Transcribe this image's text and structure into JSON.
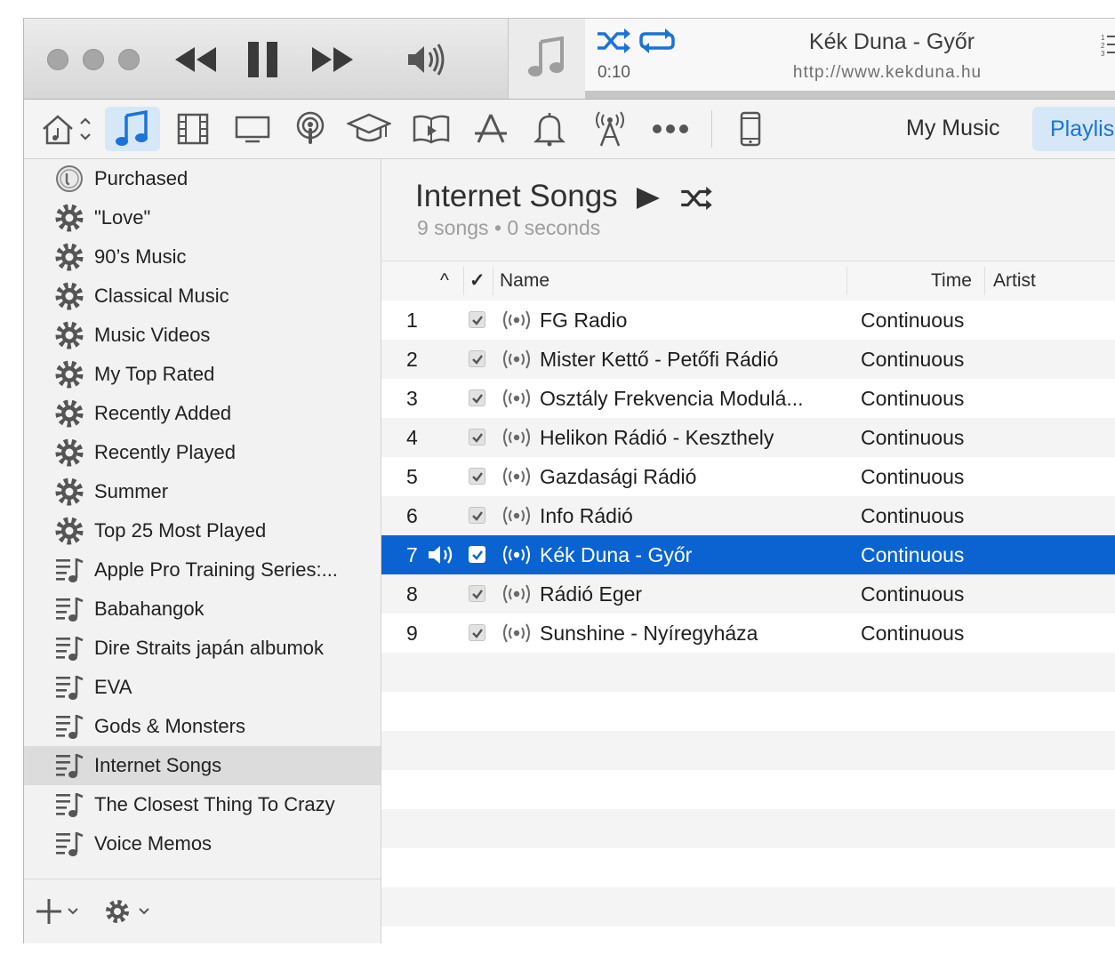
{
  "colors": {
    "accent": "#0a63d1",
    "selected_nav_bg": "#d6e7f7",
    "toolbar_icon": "#555555"
  },
  "now_playing": {
    "title": "Kék Duna - Győr",
    "subtitle": "http://www.kekduna.hu",
    "elapsed": "0:10"
  },
  "nav": {
    "icons": [
      "home-music-icon",
      "music-icon",
      "movies-icon",
      "tv-icon",
      "podcasts-icon",
      "itunes-u-icon",
      "books-icon",
      "apps-icon",
      "tones-icon",
      "radio-icon",
      "more-icon",
      "device-icon"
    ],
    "my_music": "My Music",
    "playlists": "Playlis"
  },
  "sidebar": {
    "items": [
      {
        "label": "Purchased",
        "icon": "purchased-icon"
      },
      {
        "label": "\"Love\"",
        "icon": "smart-playlist-gear-icon"
      },
      {
        "label": "90’s Music",
        "icon": "smart-playlist-gear-icon"
      },
      {
        "label": "Classical Music",
        "icon": "smart-playlist-gear-icon"
      },
      {
        "label": "Music Videos",
        "icon": "smart-playlist-gear-icon"
      },
      {
        "label": "My Top Rated",
        "icon": "smart-playlist-gear-icon"
      },
      {
        "label": "Recently Added",
        "icon": "smart-playlist-gear-icon"
      },
      {
        "label": "Recently Played",
        "icon": "smart-playlist-gear-icon"
      },
      {
        "label": "Summer",
        "icon": "smart-playlist-gear-icon"
      },
      {
        "label": "Top 25 Most Played",
        "icon": "smart-playlist-gear-icon"
      },
      {
        "label": "Apple Pro Training Series:...",
        "icon": "playlist-icon"
      },
      {
        "label": "Babahangok",
        "icon": "playlist-icon"
      },
      {
        "label": "Dire Straits japán albumok",
        "icon": "playlist-icon"
      },
      {
        "label": "EVA",
        "icon": "playlist-icon"
      },
      {
        "label": "Gods & Monsters",
        "icon": "playlist-icon"
      },
      {
        "label": "Internet Songs",
        "icon": "playlist-icon"
      },
      {
        "label": "The Closest Thing To Crazy",
        "icon": "playlist-icon"
      },
      {
        "label": "Voice Memos",
        "icon": "playlist-icon"
      }
    ],
    "selected_index": 15
  },
  "playlist": {
    "title": "Internet Songs",
    "subtitle": "9 songs • 0 seconds"
  },
  "columns": {
    "sort_arrow": "^",
    "check": "✓",
    "name": "Name",
    "time": "Time",
    "artist": "Artist"
  },
  "songs": [
    {
      "num": "1",
      "name": "FG Radio",
      "time": "Continuous"
    },
    {
      "num": "2",
      "name": "Mister Kettő - Petőfi Rádió",
      "time": "Continuous"
    },
    {
      "num": "3",
      "name": "Osztály Frekvencia Modulá...",
      "time": "Continuous"
    },
    {
      "num": "4",
      "name": "Helikon Rádió - Keszthely",
      "time": "Continuous"
    },
    {
      "num": "5",
      "name": "Gazdasági Rádió",
      "time": "Continuous"
    },
    {
      "num": "6",
      "name": "Info Rádió",
      "time": "Continuous"
    },
    {
      "num": "7",
      "name": "Kék Duna - Győr",
      "time": "Continuous"
    },
    {
      "num": "8",
      "name": "Rádió Eger",
      "time": "Continuous"
    },
    {
      "num": "9",
      "name": "Sunshine - Nyíregyháza",
      "time": "Continuous"
    }
  ],
  "playing_index": 6
}
